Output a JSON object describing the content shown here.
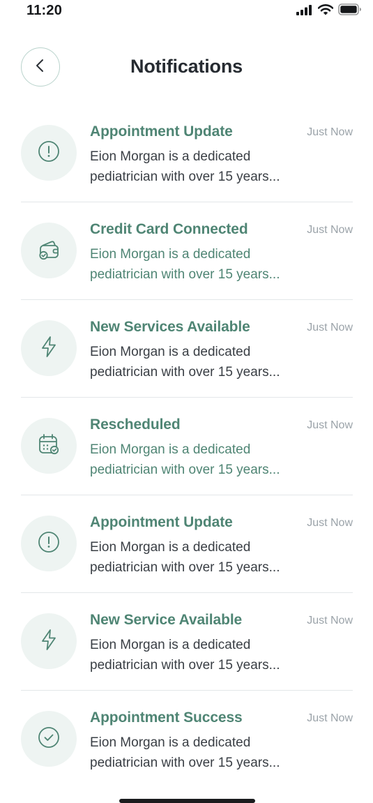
{
  "status_bar": {
    "time": "11:20"
  },
  "header": {
    "title": "Notifications",
    "back_icon": "chevron-left-icon"
  },
  "colors": {
    "accent": "#4f8574",
    "icon_bg": "#eef4f2",
    "divider": "#e3e7e9",
    "time_text": "#9ba3a9"
  },
  "notifications": [
    {
      "icon": "alert-circle-icon",
      "title": "Appointment Update",
      "time": "Just Now",
      "body": "Eion Morgan is a dedicated pediatrician with over 15 years...",
      "highlighted": false
    },
    {
      "icon": "wallet-check-icon",
      "title": "Credit Card Connected",
      "time": "Just Now",
      "body": "Eion Morgan is a dedicated pediatrician with over 15 years...",
      "highlighted": true
    },
    {
      "icon": "lightning-icon",
      "title": "New Services Available",
      "time": "Just Now",
      "body": "Eion Morgan is a dedicated pediatrician with over 15 years...",
      "highlighted": false
    },
    {
      "icon": "calendar-check-icon",
      "title": "Rescheduled",
      "time": "Just Now",
      "body": "Eion Morgan is a dedicated pediatrician with over 15 years...",
      "highlighted": true
    },
    {
      "icon": "alert-circle-icon",
      "title": "Appointment Update",
      "time": "Just Now",
      "body": "Eion Morgan is a dedicated pediatrician with over 15 years...",
      "highlighted": false
    },
    {
      "icon": "lightning-icon",
      "title": "New Service Available",
      "time": "Just Now",
      "body": "Eion Morgan is a dedicated pediatrician with over 15 years...",
      "highlighted": false
    },
    {
      "icon": "check-circle-icon",
      "title": "Appointment Success",
      "time": "Just Now",
      "body": "Eion Morgan is a dedicated pediatrician with over 15 years...",
      "highlighted": false
    }
  ]
}
